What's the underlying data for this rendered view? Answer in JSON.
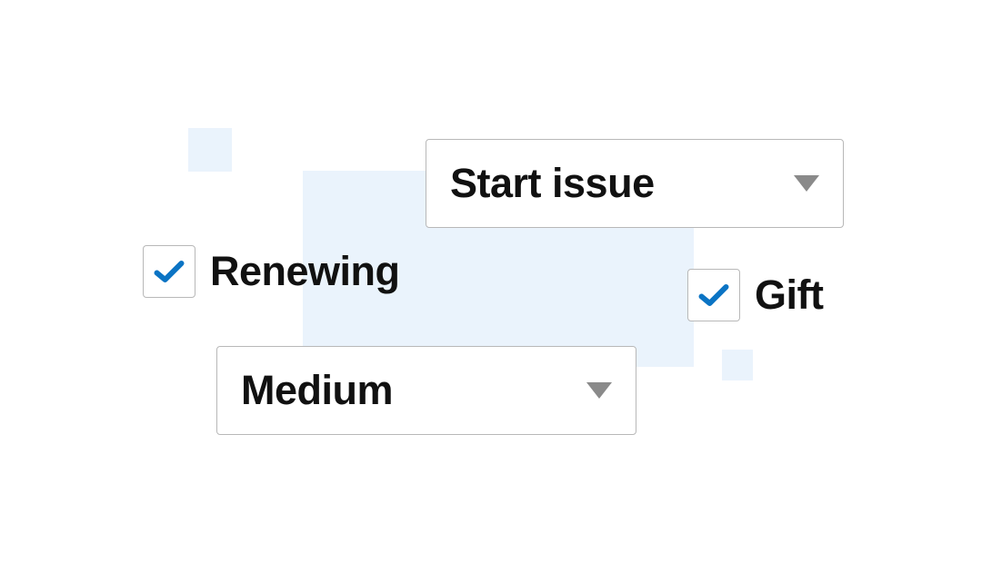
{
  "dropdowns": {
    "start_issue": {
      "label": "Start issue"
    },
    "medium": {
      "label": "Medium"
    }
  },
  "checkboxes": {
    "renewing": {
      "label": "Renewing",
      "checked": true
    },
    "gift": {
      "label": "Gift",
      "checked": true
    }
  },
  "colors": {
    "accent": "#0b74c4",
    "bg_tint": "#eaf3fc",
    "border": "#b8b8b8"
  }
}
